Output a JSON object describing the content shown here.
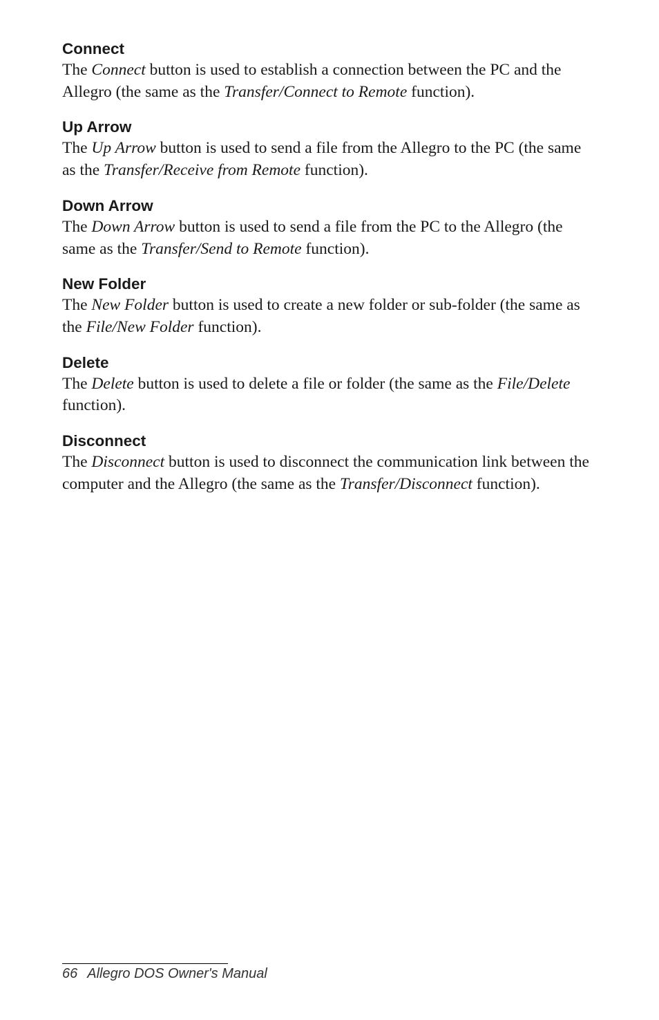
{
  "sections": {
    "connect": {
      "heading": "Connect",
      "p1a": "The ",
      "p1i": "Connect",
      "p1b": " button is used to establish a connection between the PC and the Allegro (the same as the ",
      "p1c": "Transfer/Connect to Remote",
      "p1d": " function)."
    },
    "uparrow": {
      "heading": "Up Arrow",
      "p1a": "The ",
      "p1i": "Up Arrow",
      "p1b": " button is used to send a file from the Allegro to the PC (the same as the ",
      "p1c": "Transfer/Receive from Remote",
      "p1d": " function)."
    },
    "downarrow": {
      "heading": "Down Arrow",
      "p1a": "The ",
      "p1i": "Down Arrow",
      "p1b": " button is used to send a file from the PC to the Allegro (the same as the ",
      "p1c": "Transfer/Send to Remote",
      "p1d": " function)."
    },
    "newfolder": {
      "heading": "New Folder",
      "p1a": "The ",
      "p1i": "New Folder",
      "p1b": " button is used to create a new folder or sub-folder (the same as the ",
      "p1c": "File/New Folder",
      "p1d": " function)."
    },
    "delete": {
      "heading": "Delete",
      "p1a": "The ",
      "p1i": "Delete",
      "p1b": " button is used to delete a file or folder (the same as the ",
      "p1c": "File/Delete",
      "p1d": " function)."
    },
    "disconnect": {
      "heading": "Disconnect",
      "p1a": "The ",
      "p1i": "Disconnect",
      "p1b": " button is used to disconnect the communication link between the computer and the Allegro (the same as the ",
      "p1c": "Transfer/Disconnect",
      "p1d": " function)."
    }
  },
  "footer": {
    "page": "66",
    "title": "Allegro DOS Owner's Manual"
  }
}
